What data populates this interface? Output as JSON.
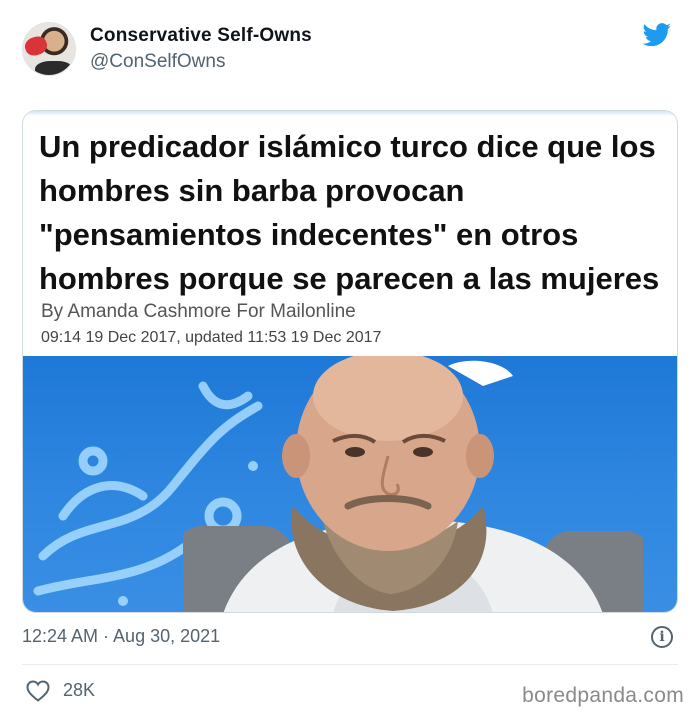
{
  "author": {
    "name": "Conservative Self-Owns",
    "handle": "@ConSelfOwns",
    "avatar_icon": "profile-photo-boxing-glove"
  },
  "brand": {
    "icon": "twitter-bird-icon",
    "color": "#1d9bf0"
  },
  "article": {
    "headline": "Un predicador islámico turco dice que los hombres sin barba provocan \"pensamientos indecentes\" en otros hombres porque se parecen a las mujeres",
    "byline": "By Amanda Cashmore For Mailonline",
    "dateline": "09:14 19 Dec 2017, updated 11:53 19 Dec 2017",
    "photo_subject": "bearded-preacher-on-blue-tv-set"
  },
  "tweet": {
    "timestamp": "12:24 AM · Aug 30, 2021",
    "likes": "28K",
    "info_icon": "info-icon"
  },
  "watermark": "boredpanda.com"
}
